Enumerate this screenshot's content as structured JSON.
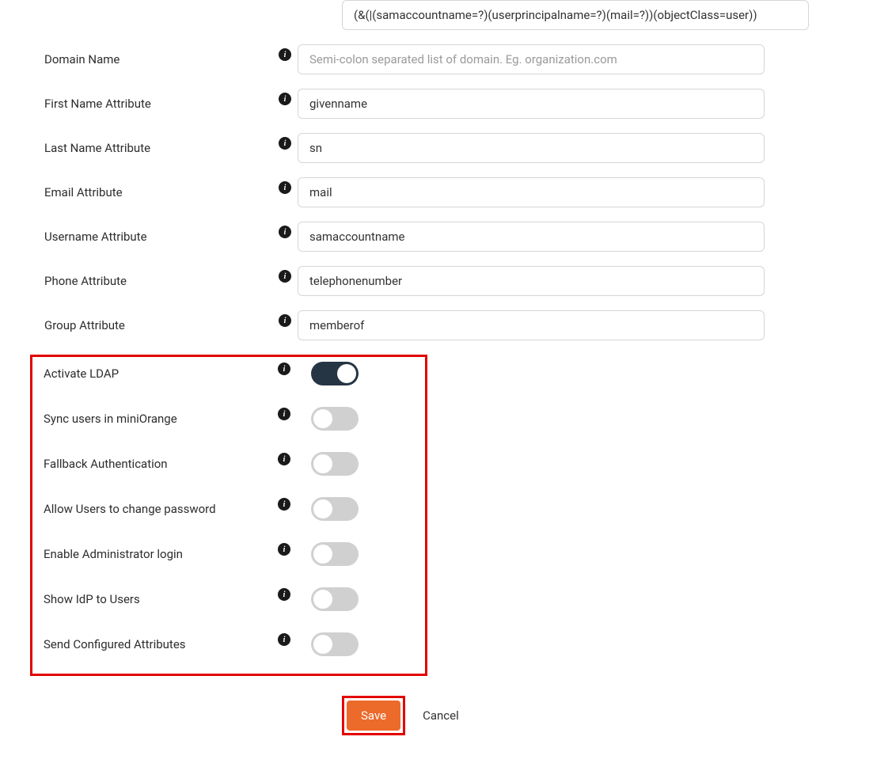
{
  "fields": {
    "filter": {
      "value": "(&(|(samaccountname=?)(userprincipalname=?)(mail=?))(objectClass=user))"
    },
    "domain_name": {
      "label": "Domain Name",
      "placeholder": "Semi-colon separated list of domain. Eg. organization.com",
      "value": ""
    },
    "first_name_attr": {
      "label": "First Name Attribute",
      "value": "givenname"
    },
    "last_name_attr": {
      "label": "Last Name Attribute",
      "value": "sn"
    },
    "email_attr": {
      "label": "Email Attribute",
      "value": "mail"
    },
    "username_attr": {
      "label": "Username Attribute",
      "value": "samaccountname"
    },
    "phone_attr": {
      "label": "Phone Attribute",
      "value": "telephonenumber"
    },
    "group_attr": {
      "label": "Group Attribute",
      "value": "memberof"
    }
  },
  "toggles": {
    "activate_ldap": {
      "label": "Activate LDAP",
      "on": true
    },
    "sync_users": {
      "label": "Sync users in miniOrange",
      "on": false
    },
    "fallback_auth": {
      "label": "Fallback Authentication",
      "on": false
    },
    "allow_change_pw": {
      "label": "Allow Users to change password",
      "on": false
    },
    "enable_admin_login": {
      "label": "Enable Administrator login",
      "on": false
    },
    "show_idp": {
      "label": "Show IdP to Users",
      "on": false
    },
    "send_conf_attrs": {
      "label": "Send Configured Attributes",
      "on": false
    }
  },
  "buttons": {
    "save": "Save",
    "cancel": "Cancel"
  }
}
